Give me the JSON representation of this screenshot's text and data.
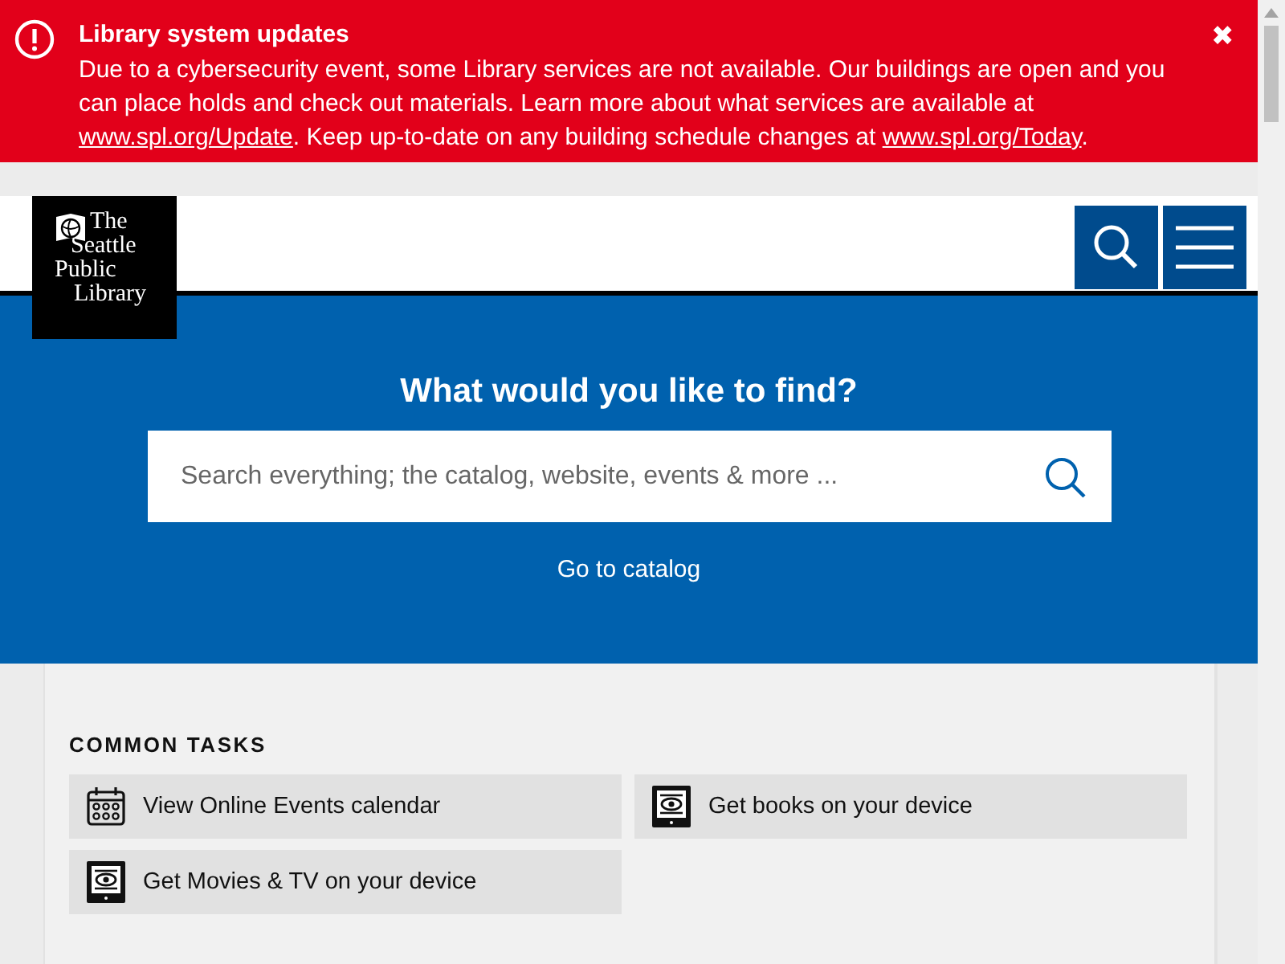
{
  "alert": {
    "title": "Library system updates",
    "text_before": "Due to a cybersecurity event, some Library services are not available. Our buildings are open and you can place holds and check out materials. Learn more about what services are available at",
    "link_1": "www.spl.org/Update",
    "text_middle": ". Keep up-to-date on any building schedule changes at",
    "link_2": "www.spl.org/Today",
    "text_after": ".",
    "close": "✖"
  },
  "logo": {
    "lines": [
      "The",
      "Seattle",
      "Public",
      "Library"
    ]
  },
  "hero": {
    "heading": "What would you like to find?",
    "search": {
      "placeholder": "Search everything; the catalog, website, events & more ..."
    },
    "link": "Go to catalog"
  },
  "common_tasks": {
    "heading": "COMMON TASKS",
    "items": [
      {
        "label": "View Online Events calendar",
        "kind": "calendar"
      },
      {
        "label": "Get books on your device",
        "kind": "device"
      },
      {
        "label": "Get Movies & TV on your device",
        "kind": "device"
      }
    ]
  }
}
